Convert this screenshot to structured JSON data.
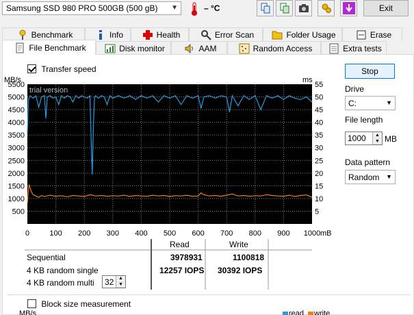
{
  "toolbar": {
    "drive": "Samsung SSD 980 PRO 500GB (500 gB)",
    "temperature": "– °C",
    "exit_label": "Exit"
  },
  "tabs_row1": [
    {
      "label": "Benchmark",
      "icon": "benchmark-icon"
    },
    {
      "label": "Info",
      "icon": "info-icon"
    },
    {
      "label": "Health",
      "icon": "health-cross-icon"
    },
    {
      "label": "Error Scan",
      "icon": "error-scan-icon"
    },
    {
      "label": "Folder Usage",
      "icon": "folder-icon"
    },
    {
      "label": "Erase",
      "icon": "erase-icon"
    }
  ],
  "tabs_row2": [
    {
      "label": "File Benchmark",
      "icon": "file-benchmark-icon",
      "active": true
    },
    {
      "label": "Disk monitor",
      "icon": "disk-monitor-icon"
    },
    {
      "label": "AAM",
      "icon": "speaker-icon"
    },
    {
      "label": "Random Access",
      "icon": "random-access-icon"
    },
    {
      "label": "Extra tests",
      "icon": "extra-tests-icon"
    }
  ],
  "options": {
    "transfer_speed_label": "Transfer speed",
    "transfer_speed_checked": true,
    "block_size_label": "Block size measurement",
    "block_size_checked": false
  },
  "side": {
    "stop_label": "Stop",
    "drive_label": "Drive",
    "drive_value": "C:",
    "file_length_label": "File length",
    "file_length_value": "1000",
    "file_length_unit": "MB",
    "data_pattern_label": "Data pattern",
    "data_pattern_value": "Random"
  },
  "chart_data": {
    "type": "line",
    "watermark": "trial version",
    "ylabel_left": "MB/s",
    "ylabel_right": "ms",
    "xlabel_unit": "mB",
    "y_left_ticks": [
      500,
      1000,
      1500,
      2000,
      2500,
      3000,
      3500,
      4000,
      4500,
      5000,
      5500
    ],
    "y_right_ticks": [
      5,
      10,
      15,
      20,
      25,
      30,
      35,
      40,
      45,
      50,
      55
    ],
    "x_ticks": [
      0,
      100,
      200,
      300,
      400,
      500,
      600,
      700,
      800,
      900,
      1000
    ],
    "ylim": [
      0,
      5500
    ],
    "xlim": [
      0,
      1000
    ],
    "colors": {
      "read": "#1ba1e2",
      "write": "#f0820f",
      "grid": "#808080",
      "bg": "#000000"
    },
    "series": [
      {
        "name": "read",
        "x": [
          0,
          4,
          10,
          20,
          30,
          40,
          50,
          60,
          65,
          70,
          80,
          90,
          100,
          110,
          120,
          130,
          140,
          150,
          160,
          170,
          180,
          190,
          200,
          210,
          220,
          225,
          228,
          232,
          236,
          240,
          250,
          260,
          270,
          280,
          290,
          300,
          320,
          340,
          360,
          380,
          400,
          420,
          440,
          460,
          480,
          500,
          520,
          540,
          560,
          580,
          600,
          610,
          620,
          640,
          660,
          680,
          700,
          710,
          720,
          740,
          760,
          780,
          800,
          820,
          840,
          860,
          880,
          900,
          920,
          940,
          960,
          980,
          1000
        ],
        "values": [
          3600,
          4900,
          5050,
          4950,
          5050,
          4600,
          5000,
          5050,
          4150,
          5000,
          5050,
          4950,
          5000,
          4700,
          5050,
          4950,
          5050,
          5000,
          4800,
          5050,
          4950,
          5050,
          5000,
          4950,
          5050,
          2900,
          1950,
          3900,
          5000,
          5050,
          4950,
          5050,
          5000,
          4700,
          5050,
          4950,
          5050,
          4950,
          5050,
          4900,
          5050,
          4950,
          5050,
          4800,
          5050,
          4950,
          5050,
          4700,
          5050,
          4950,
          5050,
          4550,
          5000,
          5050,
          4950,
          5050,
          5000,
          4400,
          5050,
          4650,
          5050,
          4900,
          5050,
          4500,
          5050,
          4950,
          5050,
          4900,
          5050,
          4950,
          4900,
          5000,
          4800
        ]
      },
      {
        "name": "write",
        "x": [
          0,
          3,
          6,
          10,
          15,
          20,
          30,
          40,
          50,
          60,
          80,
          100,
          120,
          140,
          160,
          180,
          200,
          220,
          240,
          260,
          280,
          300,
          320,
          340,
          360,
          380,
          400,
          420,
          440,
          460,
          480,
          500,
          520,
          540,
          560,
          580,
          600,
          610,
          620,
          640,
          660,
          680,
          700,
          720,
          740,
          760,
          780,
          800,
          820,
          840,
          860,
          880,
          900,
          920,
          940,
          960,
          980,
          1000
        ],
        "values": [
          800,
          1200,
          1550,
          1400,
          1250,
          1150,
          1100,
          1050,
          1120,
          1080,
          1130,
          1090,
          1110,
          1070,
          1120,
          1100,
          1080,
          1150,
          1100,
          1120,
          1090,
          1110,
          1100,
          1130,
          1080,
          1120,
          1100,
          1090,
          1130,
          1100,
          1120,
          1080,
          1110,
          1100,
          1130,
          1090,
          1100,
          1220,
          1150,
          1100,
          1120,
          1090,
          1130,
          1180,
          1100,
          1120,
          1090,
          1110,
          1100,
          1150,
          1120,
          1100,
          1090,
          1130,
          1080,
          1120,
          1140,
          1050
        ]
      }
    ]
  },
  "results": {
    "col_read": "Read",
    "col_write": "Write",
    "rows": [
      {
        "label": "Sequential",
        "read": "3978931",
        "write": "1100818"
      },
      {
        "label": "4 KB random single",
        "read": "12257 IOPS",
        "write": "30392 IOPS"
      },
      {
        "label": "4 KB random multi",
        "read": "",
        "write": ""
      }
    ],
    "multi_queue_value": "32"
  },
  "bottom": {
    "partial_axis": "MB/s",
    "legend_read": "read",
    "legend_write": "write"
  }
}
